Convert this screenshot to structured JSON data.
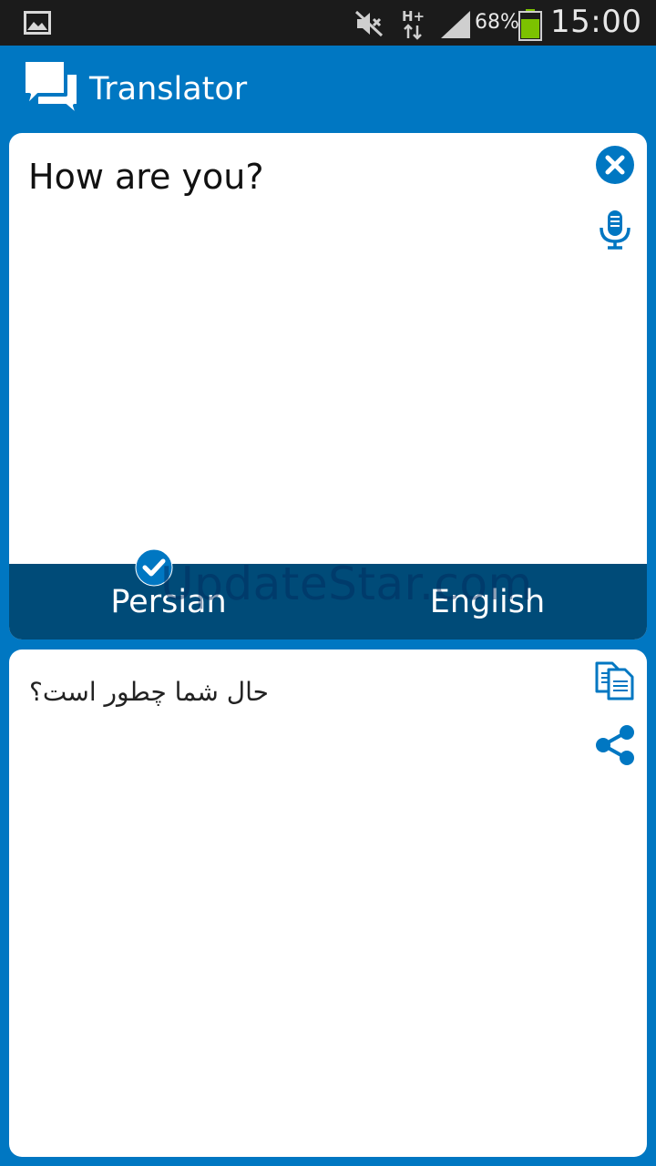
{
  "status_bar": {
    "battery_percent": "68%",
    "time": "15:00",
    "network_type": "H+",
    "icons": [
      "gallery-icon",
      "mute-icon",
      "network-icon",
      "signal-icon",
      "battery-icon"
    ]
  },
  "app_bar": {
    "title": "Translator",
    "logo_icon": "chat-bubbles-icon"
  },
  "input": {
    "text": "How are you?",
    "clear_icon": "close-circle-icon",
    "mic_icon": "microphone-icon"
  },
  "languages": {
    "source": "Persian",
    "target": "English",
    "selected": "Persian"
  },
  "watermark": "UpdateStar.com",
  "output": {
    "text": "حال شما چطور است؟",
    "copy_icon": "copy-icon",
    "share_icon": "share-icon"
  },
  "colors": {
    "primary": "#0077c2",
    "language_bar": "#004b78",
    "status_bar": "#1b1b1b",
    "battery": "#7cc200"
  }
}
